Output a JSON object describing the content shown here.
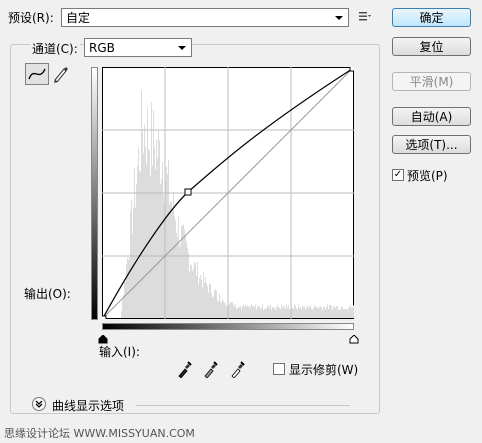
{
  "preset": {
    "label": "预设(R):",
    "value": "自定"
  },
  "channel": {
    "label": "通道(C):",
    "value": "RGB"
  },
  "buttons": {
    "ok": "确定",
    "reset": "复位",
    "smooth": "平滑(M)",
    "auto": "自动(A)",
    "options": "选项(T)..."
  },
  "preview": {
    "label": "预览(P)",
    "checked": true
  },
  "graph": {
    "output_label": "输出(O):",
    "input_label": "输入(I):",
    "curve_point": {
      "input": 66,
      "output": 102
    }
  },
  "show_clipping": {
    "label": "显示修剪(W)",
    "checked": false
  },
  "curve_display_options": "曲线显示选项",
  "watermark": "思缘设计论坛 WWW.MISSYUAN.COM"
}
